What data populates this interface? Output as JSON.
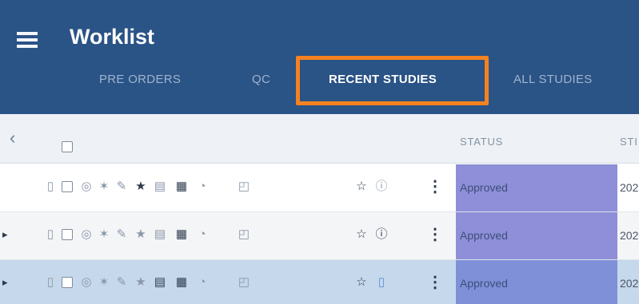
{
  "header": {
    "title": "Worklist",
    "menu_icon": "hamburger-menu-icon",
    "tabs": [
      {
        "label": "PRE ORDERS",
        "active": false
      },
      {
        "label": "QC",
        "active": false
      },
      {
        "label": "RECENT STUDIES",
        "active": true
      },
      {
        "label": "ALL STUDIES",
        "active": false
      }
    ]
  },
  "table": {
    "collapse_icon": "chevron-left-icon",
    "columns": {
      "status": "STATUS",
      "study": "STI"
    },
    "rows": [
      {
        "status": "Approved",
        "date": "202",
        "expandable": false
      },
      {
        "status": "Approved",
        "date": "202",
        "expandable": true
      },
      {
        "status": "Approved",
        "date": "202",
        "expandable": true,
        "selected": true
      }
    ]
  },
  "colors": {
    "header_bg": "#2a5386",
    "highlight": "#f58220",
    "status_cell": "#8e8fd8",
    "selected_row": "#c6d8ec"
  }
}
